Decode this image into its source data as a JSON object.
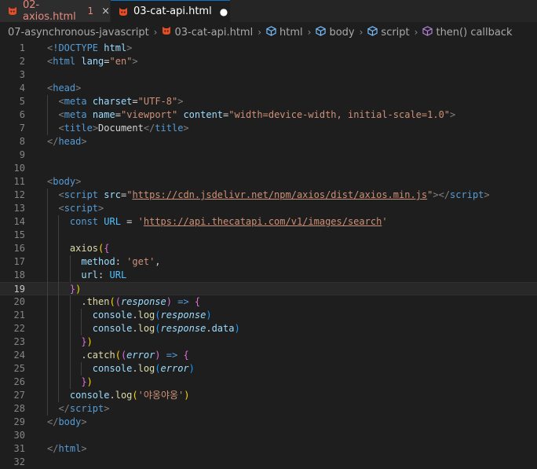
{
  "tabs": [
    {
      "label": "02-axios.html",
      "badge": "1",
      "close": "×"
    },
    {
      "label": "03-cat-api.html",
      "modified": "●"
    }
  ],
  "breadcrumb": [
    "07-asynchronous-javascript",
    "03-cat-api.html",
    "html",
    "body",
    "script",
    "then() callback"
  ],
  "colors": {
    "accent": "#0e70c0",
    "background": "#1e1e1e",
    "tab_error": "#e78a7e"
  },
  "icons": {
    "file": "html-file-icon",
    "symbol": "cube-icon",
    "separator": "chevron-right-icon"
  },
  "editor": {
    "current_line": 19,
    "lines": [
      {
        "n": "1",
        "t": [
          [
            "<",
            "bracket"
          ],
          [
            "!DOCTYPE",
            "tag"
          ],
          [
            " ",
            "txt"
          ],
          [
            "html",
            "attr"
          ],
          [
            ">",
            "bracket"
          ]
        ]
      },
      {
        "n": "2",
        "t": [
          [
            "<",
            "bracket"
          ],
          [
            "html",
            "tag"
          ],
          [
            " ",
            "txt"
          ],
          [
            "lang",
            "attr"
          ],
          [
            "=",
            "txt"
          ],
          [
            "\"en\"",
            "str"
          ],
          [
            ">",
            "bracket"
          ]
        ]
      },
      {
        "n": "3",
        "t": []
      },
      {
        "n": "4",
        "t": [
          [
            "<",
            "bracket"
          ],
          [
            "head",
            "tag"
          ],
          [
            ">",
            "bracket"
          ]
        ]
      },
      {
        "n": "5",
        "t": [
          [
            "  ",
            "txt"
          ],
          [
            "<",
            "bracket"
          ],
          [
            "meta",
            "tag"
          ],
          [
            " ",
            "txt"
          ],
          [
            "charset",
            "attr"
          ],
          [
            "=",
            "txt"
          ],
          [
            "\"UTF-8\"",
            "str"
          ],
          [
            ">",
            "bracket"
          ]
        ]
      },
      {
        "n": "6",
        "t": [
          [
            "  ",
            "txt"
          ],
          [
            "<",
            "bracket"
          ],
          [
            "meta",
            "tag"
          ],
          [
            " ",
            "txt"
          ],
          [
            "name",
            "attr"
          ],
          [
            "=",
            "txt"
          ],
          [
            "\"viewport\"",
            "str"
          ],
          [
            " ",
            "txt"
          ],
          [
            "content",
            "attr"
          ],
          [
            "=",
            "txt"
          ],
          [
            "\"width=device-width, initial-scale=1.0\"",
            "str"
          ],
          [
            ">",
            "bracket"
          ]
        ]
      },
      {
        "n": "7",
        "t": [
          [
            "  ",
            "txt"
          ],
          [
            "<",
            "bracket"
          ],
          [
            "title",
            "tag"
          ],
          [
            ">",
            "bracket"
          ],
          [
            "Document",
            "txt"
          ],
          [
            "</",
            "bracket"
          ],
          [
            "title",
            "tag"
          ],
          [
            ">",
            "bracket"
          ]
        ]
      },
      {
        "n": "8",
        "t": [
          [
            "</",
            "bracket"
          ],
          [
            "head",
            "tag"
          ],
          [
            ">",
            "bracket"
          ]
        ]
      },
      {
        "n": "9",
        "t": []
      },
      {
        "n": "10",
        "t": []
      },
      {
        "n": "11",
        "t": [
          [
            "<",
            "bracket"
          ],
          [
            "body",
            "tag"
          ],
          [
            ">",
            "bracket"
          ]
        ]
      },
      {
        "n": "12",
        "t": [
          [
            "  ",
            "txt"
          ],
          [
            "<",
            "bracket"
          ],
          [
            "script",
            "tag"
          ],
          [
            " ",
            "txt"
          ],
          [
            "src",
            "attr"
          ],
          [
            "=",
            "txt"
          ],
          [
            "\"",
            "str"
          ],
          [
            "https://cdn.jsdelivr.net/npm/axios/dist/axios.min.js",
            "link"
          ],
          [
            "\"",
            "str"
          ],
          [
            ">",
            "bracket"
          ],
          [
            "</",
            "bracket"
          ],
          [
            "script",
            "tag"
          ],
          [
            ">",
            "bracket"
          ]
        ]
      },
      {
        "n": "13",
        "t": [
          [
            "  ",
            "txt"
          ],
          [
            "<",
            "bracket"
          ],
          [
            "script",
            "tag"
          ],
          [
            ">",
            "bracket"
          ]
        ]
      },
      {
        "n": "14",
        "t": [
          [
            "    ",
            "txt"
          ],
          [
            "const",
            "kw"
          ],
          [
            " ",
            "txt"
          ],
          [
            "URL",
            "var"
          ],
          [
            " = ",
            "txt"
          ],
          [
            "'",
            "str"
          ],
          [
            "https://api.thecatapi.com/v1/images/search",
            "link"
          ],
          [
            "'",
            "str"
          ]
        ]
      },
      {
        "n": "15",
        "t": []
      },
      {
        "n": "16",
        "t": [
          [
            "    ",
            "txt"
          ],
          [
            "axios",
            "fn"
          ],
          [
            "(",
            "y"
          ],
          [
            "{",
            "p"
          ]
        ]
      },
      {
        "n": "17",
        "t": [
          [
            "      ",
            "txt"
          ],
          [
            "method",
            "prop"
          ],
          [
            ": ",
            "txt"
          ],
          [
            "'get'",
            "str"
          ],
          [
            ",",
            "txt"
          ]
        ]
      },
      {
        "n": "18",
        "t": [
          [
            "      ",
            "txt"
          ],
          [
            "url",
            "prop"
          ],
          [
            ": ",
            "txt"
          ],
          [
            "URL",
            "var"
          ]
        ]
      },
      {
        "n": "19",
        "t": [
          [
            "    ",
            "txt"
          ],
          [
            "}",
            "p"
          ],
          [
            ")",
            "y"
          ]
        ]
      },
      {
        "n": "20",
        "t": [
          [
            "      .",
            "txt"
          ],
          [
            "then",
            "fn"
          ],
          [
            "(",
            "y"
          ],
          [
            "(",
            "p"
          ],
          [
            "response",
            "param"
          ],
          [
            ")",
            "p"
          ],
          [
            " ",
            "txt"
          ],
          [
            "=>",
            "kw"
          ],
          [
            " ",
            "txt"
          ],
          [
            "{",
            "p"
          ]
        ]
      },
      {
        "n": "21",
        "t": [
          [
            "        ",
            "txt"
          ],
          [
            "console",
            "prop"
          ],
          [
            ".",
            "txt"
          ],
          [
            "log",
            "fn"
          ],
          [
            "(",
            "b"
          ],
          [
            "response",
            "param"
          ],
          [
            ")",
            "b"
          ]
        ]
      },
      {
        "n": "22",
        "t": [
          [
            "        ",
            "txt"
          ],
          [
            "console",
            "prop"
          ],
          [
            ".",
            "txt"
          ],
          [
            "log",
            "fn"
          ],
          [
            "(",
            "b"
          ],
          [
            "response",
            "param"
          ],
          [
            ".",
            "txt"
          ],
          [
            "data",
            "prop"
          ],
          [
            ")",
            "b"
          ]
        ]
      },
      {
        "n": "23",
        "t": [
          [
            "      ",
            "txt"
          ],
          [
            "}",
            "p"
          ],
          [
            ")",
            "y"
          ]
        ]
      },
      {
        "n": "24",
        "t": [
          [
            "      .",
            "txt"
          ],
          [
            "catch",
            "fn"
          ],
          [
            "(",
            "y"
          ],
          [
            "(",
            "p"
          ],
          [
            "error",
            "param"
          ],
          [
            ")",
            "p"
          ],
          [
            " ",
            "txt"
          ],
          [
            "=>",
            "kw"
          ],
          [
            " ",
            "txt"
          ],
          [
            "{",
            "p"
          ]
        ]
      },
      {
        "n": "25",
        "t": [
          [
            "        ",
            "txt"
          ],
          [
            "console",
            "prop"
          ],
          [
            ".",
            "txt"
          ],
          [
            "log",
            "fn"
          ],
          [
            "(",
            "b"
          ],
          [
            "error",
            "param"
          ],
          [
            ")",
            "b"
          ]
        ]
      },
      {
        "n": "26",
        "t": [
          [
            "      ",
            "txt"
          ],
          [
            "}",
            "p"
          ],
          [
            ")",
            "y"
          ]
        ]
      },
      {
        "n": "27",
        "t": [
          [
            "    ",
            "txt"
          ],
          [
            "console",
            "prop"
          ],
          [
            ".",
            "txt"
          ],
          [
            "log",
            "fn"
          ],
          [
            "(",
            "y"
          ],
          [
            "'야옹야옹'",
            "str"
          ],
          [
            ")",
            "y"
          ]
        ]
      },
      {
        "n": "28",
        "t": [
          [
            "  ",
            "txt"
          ],
          [
            "</",
            "bracket"
          ],
          [
            "script",
            "tag"
          ],
          [
            ">",
            "bracket"
          ]
        ]
      },
      {
        "n": "29",
        "t": [
          [
            "</",
            "bracket"
          ],
          [
            "body",
            "tag"
          ],
          [
            ">",
            "bracket"
          ]
        ]
      },
      {
        "n": "30",
        "t": []
      },
      {
        "n": "31",
        "t": [
          [
            "</",
            "bracket"
          ],
          [
            "html",
            "tag"
          ],
          [
            ">",
            "bracket"
          ]
        ]
      },
      {
        "n": "32",
        "t": []
      }
    ]
  }
}
